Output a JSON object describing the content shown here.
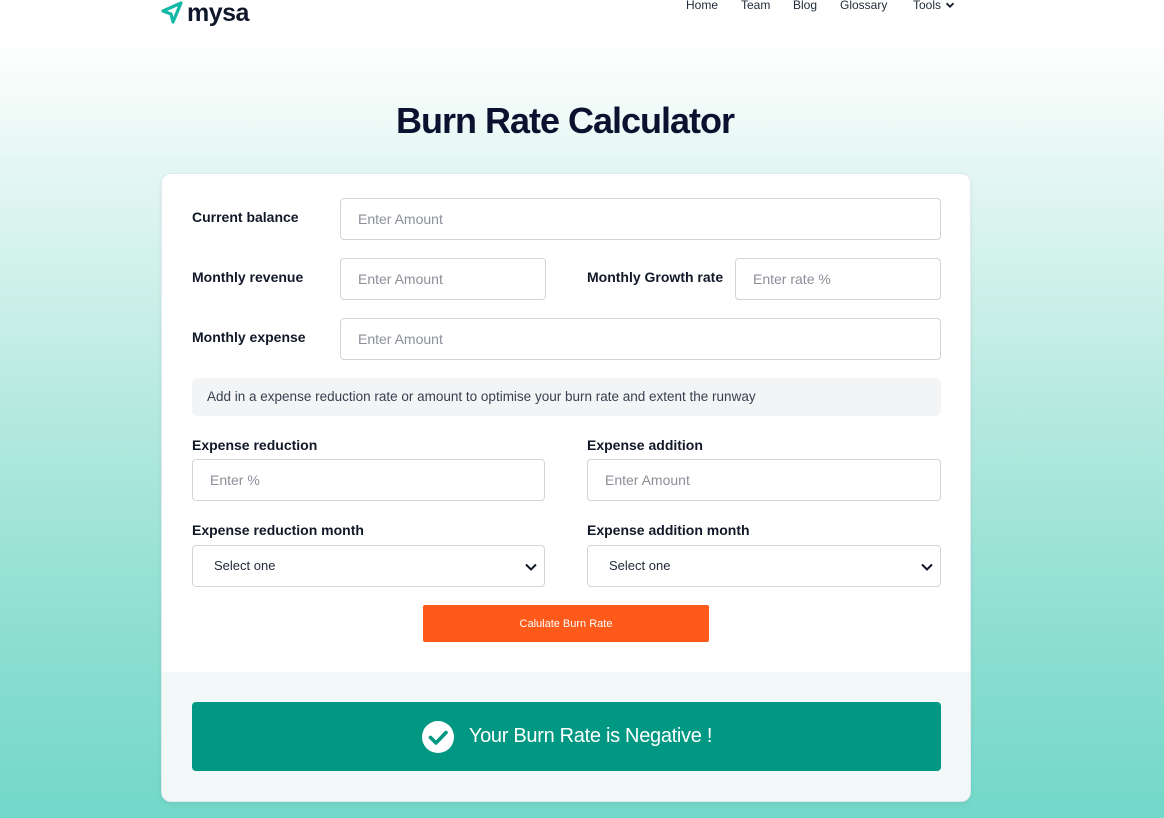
{
  "header": {
    "logo_text": "mysa",
    "nav": {
      "home": "Home",
      "team": "Team",
      "blog": "Blog",
      "glossary": "Glossary",
      "tools": "Tools"
    }
  },
  "page_title": "Burn Rate Calculator",
  "form": {
    "current_balance": {
      "label": "Current balance",
      "placeholder": "Enter Amount",
      "value": ""
    },
    "monthly_revenue": {
      "label": "Monthly revenue",
      "placeholder": "Enter Amount",
      "value": ""
    },
    "monthly_growth_rate": {
      "label": "Monthly Growth rate",
      "placeholder": "Enter rate %",
      "value": ""
    },
    "monthly_expense": {
      "label": "Monthly expense",
      "placeholder": "Enter Amount",
      "value": ""
    },
    "info_text": "Add in a expense reduction rate or amount to optimise your burn rate and extent the runway",
    "expense_reduction": {
      "label": "Expense reduction",
      "placeholder": "Enter %",
      "value": ""
    },
    "expense_addition": {
      "label": "Expense addition",
      "placeholder": "Enter Amount",
      "value": ""
    },
    "expense_reduction_month": {
      "label": "Expense reduction month",
      "selected": "Select one"
    },
    "expense_addition_month": {
      "label": "Expense addition month",
      "selected": "Select one"
    },
    "submit_label": "Calulate Burn Rate"
  },
  "result": {
    "icon": "check-circle-icon",
    "text": "Your Burn Rate is Negative !",
    "color": "#009882"
  },
  "colors": {
    "accent_orange": "#ff5a19",
    "brand_teal": "#14b8a6",
    "title_dark": "#0b1230"
  }
}
